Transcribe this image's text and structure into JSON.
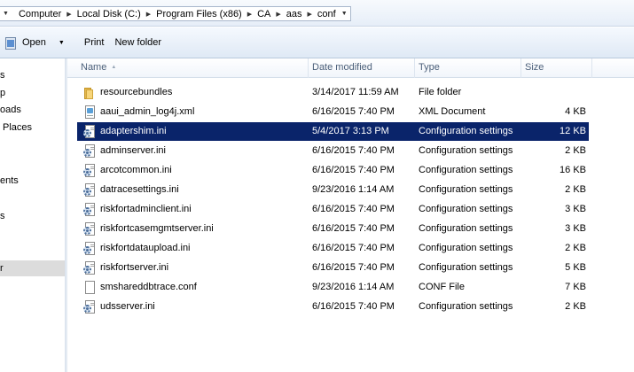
{
  "address": {
    "segments": [
      "Computer",
      "Local Disk (C:)",
      "Program Files (x86)",
      "CA",
      "aas",
      "conf"
    ]
  },
  "toolbar": {
    "open_label": "Open",
    "print_label": "Print",
    "new_folder_label": "New folder"
  },
  "nav": {
    "items": [
      "s",
      "p",
      "oads",
      "Places",
      "ents",
      "s",
      "r"
    ],
    "selected_index": 6
  },
  "columns": {
    "name": "Name",
    "date": "Date modified",
    "type": "Type",
    "size": "Size"
  },
  "files": [
    {
      "name": "resourcebundles",
      "date": "3/14/2017 11:59 AM",
      "type": "File folder",
      "size": "",
      "icon": "folder-icon"
    },
    {
      "name": "aaui_admin_log4j.xml",
      "date": "6/16/2015 7:40 PM",
      "type": "XML Document",
      "size": "4 KB",
      "icon": "xml-file-icon"
    },
    {
      "name": "adaptershim.ini",
      "date": "5/4/2017 3:13 PM",
      "type": "Configuration settings",
      "size": "12 KB",
      "icon": "config-file-icon",
      "selected": true
    },
    {
      "name": "adminserver.ini",
      "date": "6/16/2015 7:40 PM",
      "type": "Configuration settings",
      "size": "2 KB",
      "icon": "config-file-icon"
    },
    {
      "name": "arcotcommon.ini",
      "date": "6/16/2015 7:40 PM",
      "type": "Configuration settings",
      "size": "16 KB",
      "icon": "config-file-icon"
    },
    {
      "name": "datracesettings.ini",
      "date": "9/23/2016 1:14 AM",
      "type": "Configuration settings",
      "size": "2 KB",
      "icon": "config-file-icon"
    },
    {
      "name": "riskfortadminclient.ini",
      "date": "6/16/2015 7:40 PM",
      "type": "Configuration settings",
      "size": "3 KB",
      "icon": "config-file-icon"
    },
    {
      "name": "riskfortcasemgmtserver.ini",
      "date": "6/16/2015 7:40 PM",
      "type": "Configuration settings",
      "size": "3 KB",
      "icon": "config-file-icon"
    },
    {
      "name": "riskfortdataupload.ini",
      "date": "6/16/2015 7:40 PM",
      "type": "Configuration settings",
      "size": "2 KB",
      "icon": "config-file-icon"
    },
    {
      "name": "riskfortserver.ini",
      "date": "6/16/2015 7:40 PM",
      "type": "Configuration settings",
      "size": "5 KB",
      "icon": "config-file-icon"
    },
    {
      "name": "smshareddbtrace.conf",
      "date": "9/23/2016 1:14 AM",
      "type": "CONF File",
      "size": "7 KB",
      "icon": "file-icon"
    },
    {
      "name": "udsserver.ini",
      "date": "6/16/2015 7:40 PM",
      "type": "Configuration settings",
      "size": "2 KB",
      "icon": "config-file-icon"
    }
  ]
}
